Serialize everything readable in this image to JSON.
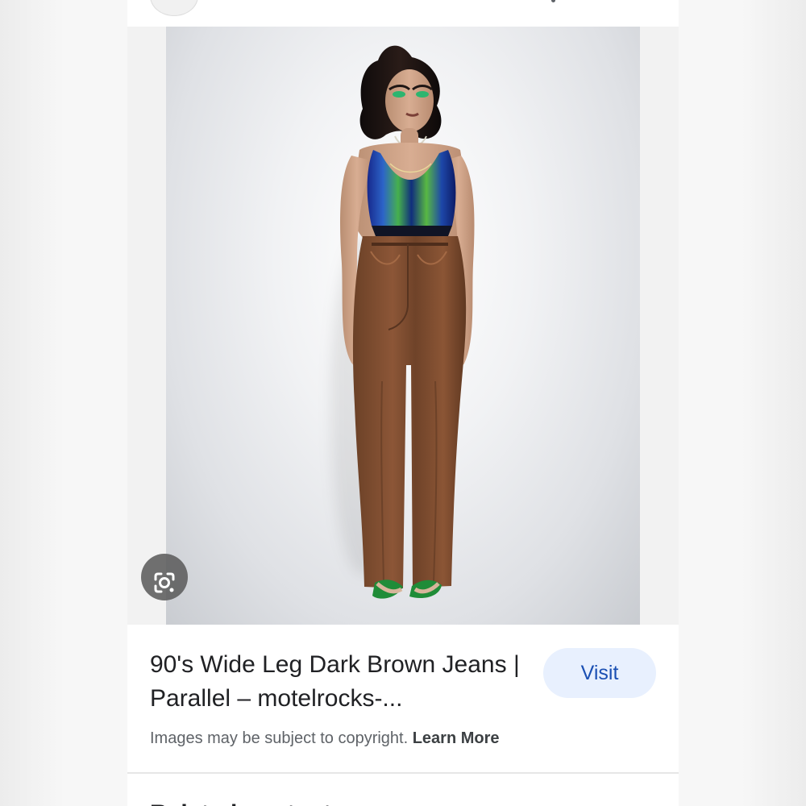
{
  "result": {
    "title": "90's Wide Leg Dark Brown Jeans | Parallel – motelrocks-...",
    "visit_label": "Visit",
    "copyright_text": "Images may be subject to copyright.",
    "learn_more_label": "Learn More"
  },
  "next_section": {
    "heading": "Related content"
  },
  "icons": {
    "lens": "google-lens-icon",
    "more": "more-options-icon"
  },
  "colors": {
    "visit_background": "#e8f0fe",
    "visit_text": "#1a4fb3",
    "lens_background": "#5a5a5a"
  }
}
